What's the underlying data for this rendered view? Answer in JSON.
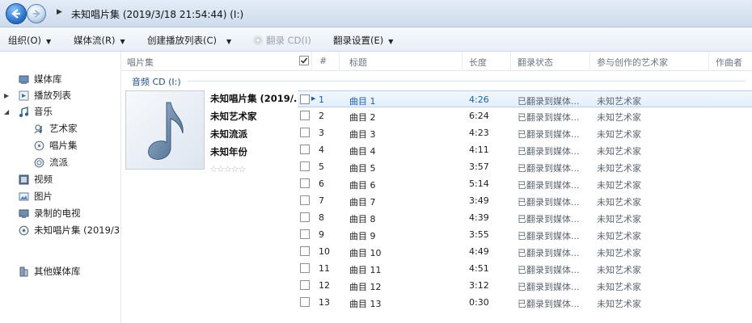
{
  "address_bar": {
    "breadcrumb": "未知唱片集 (2019/3/18 21:54:44) (I:)"
  },
  "toolbar": {
    "organize": "组织(O)",
    "stream": "媒体流(R)",
    "create_playlist": "创建播放列表(C)",
    "rip_cd": "翻录 CD(I)",
    "rip_settings": "翻录设置(E)"
  },
  "nav": {
    "items": [
      {
        "label": "媒体库",
        "icon": "library-icon"
      },
      {
        "label": "播放列表",
        "icon": "playlist-icon"
      },
      {
        "label": "音乐",
        "icon": "music-note-icon"
      },
      {
        "label": "艺术家",
        "icon": "artist-icon"
      },
      {
        "label": "唱片集",
        "icon": "album-icon"
      },
      {
        "label": "流派",
        "icon": "genre-icon"
      },
      {
        "label": "视频",
        "icon": "video-icon"
      },
      {
        "label": "图片",
        "icon": "picture-icon"
      },
      {
        "label": "录制的电视",
        "icon": "tv-icon"
      },
      {
        "label": "未知唱片集 (2019/3",
        "icon": "cd-icon"
      },
      {
        "label": "其他媒体库",
        "icon": "other-libraries-icon"
      }
    ]
  },
  "columns": {
    "album": "唱片集",
    "number": "#",
    "title": "标题",
    "length": "长度",
    "rip_status": "翻录状态",
    "contributing_artist": "参与创作的艺术家",
    "composer": "作曲者"
  },
  "group": {
    "label": "音频 CD (I:)"
  },
  "album": {
    "name": "未知唱片集 (2019/...",
    "artist": "未知艺术家",
    "genre": "未知流派",
    "year": "未知年份",
    "rating": "☆☆☆☆☆"
  },
  "tracks": [
    {
      "num": "1",
      "title": "曲目 1",
      "length": "4:26",
      "status": "已翻录到媒体...",
      "artist": "未知艺术家",
      "selected": true
    },
    {
      "num": "2",
      "title": "曲目 2",
      "length": "6:24",
      "status": "已翻录到媒体...",
      "artist": "未知艺术家"
    },
    {
      "num": "3",
      "title": "曲目 3",
      "length": "4:23",
      "status": "已翻录到媒体...",
      "artist": "未知艺术家"
    },
    {
      "num": "4",
      "title": "曲目 4",
      "length": "4:11",
      "status": "已翻录到媒体...",
      "artist": "未知艺术家"
    },
    {
      "num": "5",
      "title": "曲目 5",
      "length": "3:57",
      "status": "已翻录到媒体...",
      "artist": "未知艺术家"
    },
    {
      "num": "6",
      "title": "曲目 6",
      "length": "5:14",
      "status": "已翻录到媒体...",
      "artist": "未知艺术家"
    },
    {
      "num": "7",
      "title": "曲目 7",
      "length": "3:49",
      "status": "已翻录到媒体...",
      "artist": "未知艺术家"
    },
    {
      "num": "8",
      "title": "曲目 8",
      "length": "4:39",
      "status": "已翻录到媒体...",
      "artist": "未知艺术家"
    },
    {
      "num": "9",
      "title": "曲目 9",
      "length": "3:55",
      "status": "已翻录到媒体...",
      "artist": "未知艺术家"
    },
    {
      "num": "10",
      "title": "曲目 10",
      "length": "4:49",
      "status": "已翻录到媒体...",
      "artist": "未知艺术家"
    },
    {
      "num": "11",
      "title": "曲目 11",
      "length": "4:51",
      "status": "已翻录到媒体...",
      "artist": "未知艺术家"
    },
    {
      "num": "12",
      "title": "曲目 12",
      "length": "3:12",
      "status": "已翻录到媒体...",
      "artist": "未知艺术家"
    },
    {
      "num": "13",
      "title": "曲目 13",
      "length": "0:30",
      "status": "已翻录到媒体...",
      "artist": "未知艺术家"
    }
  ]
}
